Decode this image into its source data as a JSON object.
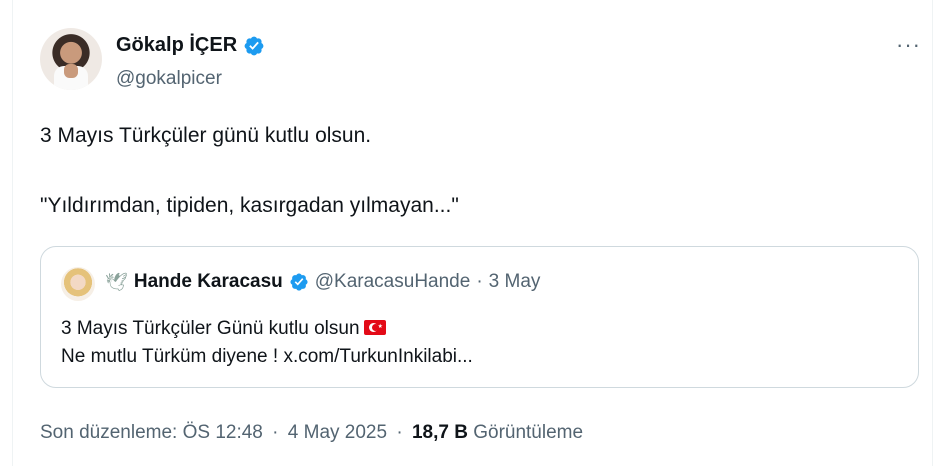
{
  "author": {
    "display_name": "Gökalp İÇER",
    "handle": "@gokalpicer"
  },
  "tweet": {
    "line1": "3 Mayıs Türkçüler günü kutlu olsun.",
    "line2": "\"Yıldırımdan, tipiden, kasırgadan yılmayan...\""
  },
  "more_label": "···",
  "quote": {
    "dove_icon": "🕊",
    "display_name": "Hande Karacasu",
    "handle": "@KaracasuHande",
    "separator": "·",
    "date": "3 May",
    "line1": "3 Mayıs Türkçüler Günü kutlu olsun",
    "line2": "Ne mutlu Türküm diyene ! x.com/TurkunInkilabi..."
  },
  "footer": {
    "edited": "Son düzenleme: ÖS 12:48",
    "separator": "·",
    "date": "4 May 2025",
    "views_count": "18,7 B",
    "views_label": "Görüntüleme"
  },
  "colors": {
    "verified": "#1d9bf0",
    "secondary_text": "#536471",
    "border": "#cfd9de",
    "flag_red": "#e30a17"
  }
}
